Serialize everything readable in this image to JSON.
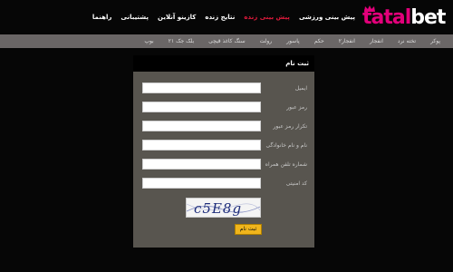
{
  "header": {
    "logo": {
      "part1": "tatal",
      "part2": "bet"
    },
    "nav": [
      {
        "label": "پیش بینی ورزشی",
        "active": false
      },
      {
        "label": "پیش بینی زنده",
        "active": true
      },
      {
        "label": "نتایج زنده",
        "active": false
      },
      {
        "label": "کازینو آنلاین",
        "active": false
      },
      {
        "label": "پشتیبانی",
        "active": false
      },
      {
        "label": "راهنما",
        "active": false
      }
    ]
  },
  "categories": [
    "پوکر",
    "تخته نرد",
    "انفجار",
    "انفجار۲",
    "حکم",
    "پاسور",
    "رولت",
    "سنگ کاغذ قیچی",
    "بلک جک ۲۱",
    "بوپ"
  ],
  "form": {
    "title": "ثبت نام",
    "fields": [
      {
        "label": "ایمیل",
        "value": ""
      },
      {
        "label": "رمز عبور",
        "value": ""
      },
      {
        "label": "تکرار رمز عبور",
        "value": ""
      },
      {
        "label": "نام و نام خانوادگی",
        "value": ""
      },
      {
        "label": "شماره تلفن همراه",
        "value": ""
      },
      {
        "label": "کد امنیتی",
        "value": ""
      }
    ],
    "captcha_text": "c5E8g",
    "submit_label": "ثبت نام"
  },
  "colors": {
    "background": "#060606",
    "brand_pink": "#e2007a",
    "nav_active": "#e01a3c",
    "category_bar": "#6a6666",
    "panel": "#58554f",
    "submit": "#f0b51c"
  }
}
